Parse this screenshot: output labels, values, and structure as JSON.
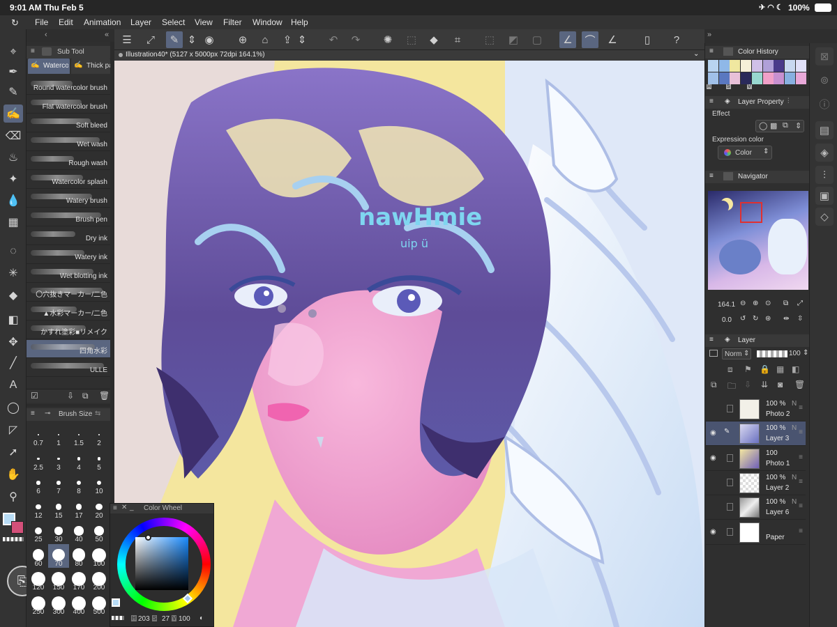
{
  "status": {
    "time": "9:01 AM",
    "date": "Thu Feb 5",
    "battery": "100%"
  },
  "menu": [
    "File",
    "Edit",
    "Animation",
    "Layer",
    "Select",
    "View",
    "Filter",
    "Window",
    "Help"
  ],
  "document": {
    "tab_title": "Illustration40* (5127 x 5000px 72dpi 164.1%)"
  },
  "sub_tool": {
    "panel_title": "Sub Tool",
    "tabs": [
      "Watercolor",
      "Thick pa"
    ],
    "brushes": [
      "Round watercolor brush",
      "Flat watercolor brush",
      "Soft bleed",
      "Wet wash",
      "Rough wash",
      "Watercolor splash",
      "Watery brush",
      "Brush pen",
      "Dry ink",
      "Watery ink",
      "Wet blotting ink",
      "〇穴抜きマーカー/二色",
      "▲水彩マーカー/二色",
      "かすれ塗彩■リメイク",
      "四角水彩",
      "ULLE"
    ],
    "selected_index": 14
  },
  "brush_size": {
    "panel_title": "Brush Size",
    "sizes": [
      "0.7",
      "1",
      "1.5",
      "2",
      "2.5",
      "3",
      "4",
      "5",
      "6",
      "7",
      "8",
      "10",
      "12",
      "15",
      "17",
      "20",
      "25",
      "30",
      "40",
      "50",
      "60",
      "70",
      "80",
      "100",
      "120",
      "150",
      "170",
      "200",
      "250",
      "300",
      "400",
      "500"
    ],
    "selected": "70"
  },
  "color_wheel": {
    "title": "Color Wheel",
    "h": "203",
    "s": "27",
    "v": "100",
    "labels": {
      "h": "H",
      "s": "S",
      "v": "V"
    }
  },
  "canvas": {
    "signature": "nawHmie",
    "signature_sub": "uip ü",
    "palette": {
      "bg": "#f3e39b",
      "hair": "#6b4f9c",
      "skin": "#e890c4",
      "wing": "#e8f2fb",
      "accent": "#7fd6f0"
    }
  },
  "right": {
    "color_history": {
      "title": "Color History",
      "swatches": [
        "#b8d4f0",
        "#8fb8e8",
        "#f0e8a0",
        "#f6f0d8",
        "#d0c0e8",
        "#b0a0d8",
        "#4a3a8a",
        "#c8d8f0",
        "#e0e0f8",
        "#a0c0e8",
        "#5a78c0",
        "#e8c0d8",
        "#2a2a5a",
        "#98d8d0",
        "#f0a0c8",
        "#c890d0",
        "#88b0e0",
        "#e8a8d8"
      ],
      "foot": [
        "H",
        "S",
        "V"
      ]
    },
    "layer_property": {
      "title": "Layer Property",
      "effect": "Effect",
      "expression_color": "Expression color",
      "color_select": "Color"
    },
    "navigator": {
      "title": "Navigator",
      "zoom": "164.1",
      "rotation": "0.0"
    },
    "layer": {
      "title": "Layer",
      "blend": "Norm",
      "opacity": "100",
      "rows": [
        {
          "pct": "100 %",
          "mode": "N",
          "name": "Photo 2",
          "visible": false,
          "selected": false
        },
        {
          "pct": "100 %",
          "mode": "N",
          "name": "Layer 3",
          "visible": true,
          "selected": true
        },
        {
          "pct": "100",
          "mode": "",
          "name": "Photo 1",
          "visible": true,
          "selected": false
        },
        {
          "pct": "100 %",
          "mode": "N",
          "name": "Layer 2",
          "visible": false,
          "selected": false
        },
        {
          "pct": "100 %",
          "mode": "N",
          "name": "Layer 6",
          "visible": false,
          "selected": false
        },
        {
          "pct": "",
          "mode": "",
          "name": "Paper",
          "visible": true,
          "selected": false
        }
      ]
    }
  }
}
